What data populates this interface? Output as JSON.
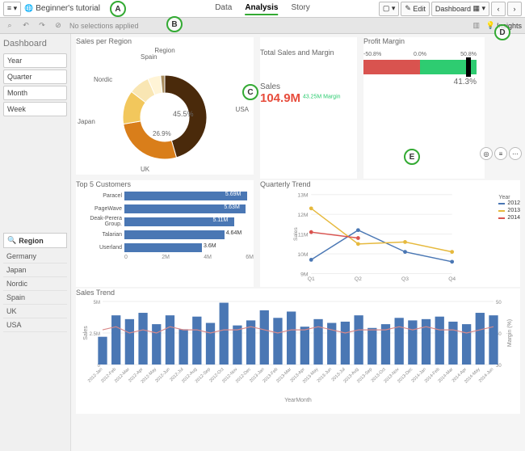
{
  "topbar": {
    "menu_icon": "≡ ▾",
    "app_title": "Beginner's tutorial",
    "tabs": {
      "data": "Data",
      "analysis": "Analysis",
      "story": "Story"
    },
    "bookmark": "▢ ▾",
    "edit": "Edit",
    "sheet_label": "Dashboard",
    "prev": "‹",
    "next": "›"
  },
  "selbar": {
    "no_selections": "No selections applied",
    "insights": "Insights"
  },
  "sidebar": {
    "title": "Dashboard",
    "fields": [
      "Year",
      "Quarter",
      "Month",
      "Week"
    ],
    "region_head": "Region",
    "regions": [
      "Germany",
      "Japan",
      "Nordic",
      "Spain",
      "UK",
      "USA"
    ]
  },
  "callouts": {
    "a": "A",
    "b": "B",
    "c": "C",
    "d": "D",
    "e": "E"
  },
  "salesRegion": {
    "title": "Sales per Region",
    "legend_title": "Region",
    "center_big": "45.5%",
    "center_small": "26.9%"
  },
  "totals": {
    "title": "Total Sales and Margin",
    "sales_label": "Sales",
    "sales_value": "104.9M",
    "margin_sup": "43.25M Margin"
  },
  "profitMargin": {
    "title": "Profit Margin",
    "left": "-50.8%",
    "mid": "0.0%",
    "right": "50.8%",
    "value": "41.3%"
  },
  "top5": {
    "title": "Top 5 Customers",
    "max_label0": "0",
    "max_label2": "2M",
    "max_label4": "4M",
    "max_label6": "6M"
  },
  "quarterly": {
    "title": "Quarterly Trend",
    "ylabel": "Sales",
    "legend": "Year"
  },
  "salesTrend": {
    "title": "Sales Trend",
    "ylabel": "Sales",
    "y2label": "Margin (%)",
    "xlabel": "YearMonth"
  },
  "actions": {
    "cam": "◎",
    "bars": "≡",
    "more": "⋯"
  },
  "chart_data": [
    {
      "id": "sales_per_region",
      "type": "donut",
      "title": "Sales per Region",
      "series": [
        {
          "name": "USA",
          "value": 45.5,
          "color": "#4a2a0b"
        },
        {
          "name": "UK",
          "value": 26.9,
          "color": "#d97e1a"
        },
        {
          "name": "Japan",
          "value": 13.0,
          "color": "#f2c75c"
        },
        {
          "name": "Nordic",
          "value": 8.0,
          "color": "#f9e6b3"
        },
        {
          "name": "Spain",
          "value": 5.0,
          "color": "#fff4d6"
        },
        {
          "name": "Germany",
          "value": 1.6,
          "color": "#aa8e60"
        }
      ]
    },
    {
      "id": "total_sales_margin",
      "type": "kpi",
      "title": "Total Sales and Margin",
      "sales": 104900000,
      "margin": 43250000
    },
    {
      "id": "profit_margin",
      "type": "gauge-bar",
      "title": "Profit Margin",
      "range": [
        -50.8,
        50.8
      ],
      "value": 41.3,
      "segments": [
        {
          "from": -50.8,
          "to": 0.0,
          "color": "#d9534f"
        },
        {
          "from": 0.0,
          "to": 50.8,
          "color": "#2ecc71"
        }
      ]
    },
    {
      "id": "top5_customers",
      "type": "bar-horizontal",
      "title": "Top 5 Customers",
      "xlim": [
        0,
        6000000
      ],
      "categories": [
        "Paracel",
        "PageWave",
        "Deak-Perera Group.",
        "Talarian",
        "Userland"
      ],
      "values": [
        5690000,
        5630000,
        5110000,
        4640000,
        3600000
      ],
      "labels": [
        "5.69M",
        "5.63M",
        "5.11M",
        "4.64M",
        "3.6M"
      ]
    },
    {
      "id": "quarterly_trend",
      "type": "line",
      "title": "Quarterly Trend",
      "xlabel": "",
      "ylabel": "Sales",
      "ylim": [
        9000000,
        13000000
      ],
      "yticks": [
        "9M",
        "10M",
        "11M",
        "12M",
        "13M"
      ],
      "categories": [
        "Q1",
        "Q2",
        "Q3",
        "Q4"
      ],
      "series": [
        {
          "name": "2012",
          "color": "#4a77b4",
          "values": [
            9700000,
            11200000,
            10100000,
            9600000
          ]
        },
        {
          "name": "2013",
          "color": "#e6b93d",
          "values": [
            12300000,
            10500000,
            10600000,
            10100000
          ]
        },
        {
          "name": "2014",
          "color": "#d9534f",
          "values": [
            11100000,
            10800000,
            null,
            null
          ]
        }
      ]
    },
    {
      "id": "sales_trend",
      "type": "combo-bar-line",
      "title": "Sales Trend",
      "xlabel": "YearMonth",
      "ylabel": "Sales",
      "ylim": [
        0,
        5000000
      ],
      "yticks": [
        "0",
        "2.5M",
        "5M"
      ],
      "y2label": "Margin (%)",
      "y2lim": [
        30,
        50
      ],
      "y2ticks": [
        "30",
        "40",
        "50"
      ],
      "categories": [
        "2012-Jan",
        "2012-Feb",
        "2012-Mar",
        "2012-Apr",
        "2012-May",
        "2012-Jun",
        "2012-Jul",
        "2012-Aug",
        "2012-Sep",
        "2012-Oct",
        "2012-Nov",
        "2012-Dec",
        "2013-Jan",
        "2013-Feb",
        "2013-Mar",
        "2013-Apr",
        "2013-May",
        "2013-Jun",
        "2013-Jul",
        "2013-Aug",
        "2013-Sep",
        "2013-Oct",
        "2013-Nov",
        "2013-Dec",
        "2014-Jan",
        "2014-Feb",
        "2014-Mar",
        "2014-Apr",
        "2014-May",
        "2014-Jun"
      ],
      "bars": [
        2200000,
        3900000,
        3600000,
        4100000,
        3200000,
        3900000,
        2800000,
        3800000,
        3300000,
        4900000,
        3100000,
        3500000,
        4300000,
        3700000,
        4200000,
        3000000,
        3600000,
        3300000,
        3400000,
        3900000,
        2900000,
        3200000,
        3700000,
        3500000,
        3600000,
        3800000,
        3400000,
        3200000,
        4100000,
        3900000
      ],
      "line_pct": [
        41,
        42,
        40,
        41,
        40,
        42,
        41,
        41,
        40,
        41,
        41,
        42,
        41,
        40,
        41,
        41,
        42,
        41,
        40,
        41,
        41,
        41,
        42,
        41,
        42,
        41,
        41,
        40,
        41,
        42
      ]
    }
  ]
}
